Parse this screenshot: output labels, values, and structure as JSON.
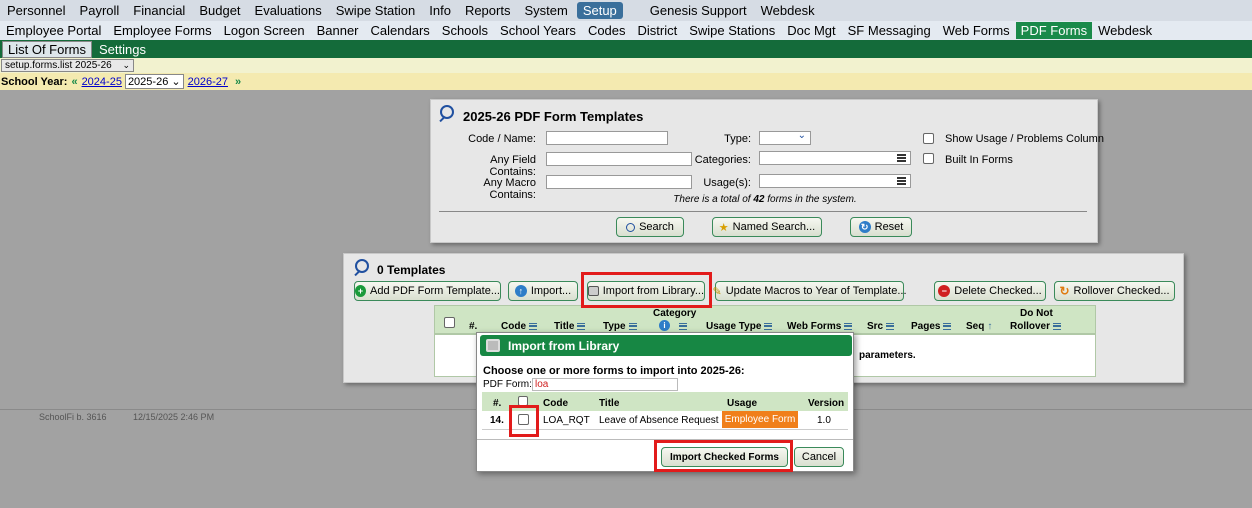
{
  "nav_top": {
    "items": [
      "Personnel",
      "Payroll",
      "Financial",
      "Budget",
      "Evaluations",
      "Swipe Station",
      "Info",
      "Reports",
      "System",
      "Setup",
      "Genesis Support",
      "Webdesk"
    ],
    "selected": "Setup"
  },
  "nav_second": {
    "items": [
      "Employee Portal",
      "Employee Forms",
      "Logon Screen",
      "Banner",
      "Calendars",
      "Schools",
      "School Years",
      "Codes",
      "District",
      "Swipe Stations",
      "Doc Mgt",
      "SF Messaging",
      "Web Forms",
      "PDF Forms",
      "Webdesk"
    ],
    "selected": "PDF Forms"
  },
  "nav_third": {
    "items": [
      "List Of Forms",
      "Settings"
    ],
    "selected": "List Of Forms"
  },
  "page_select": "setup.forms.list 2025-26",
  "school_year": {
    "label": "School Year:",
    "prev": "2024-25",
    "current": "2025-26",
    "next": "2026-27"
  },
  "search_panel": {
    "title": "2025-26 PDF Form Templates",
    "code_name_label": "Code / Name:",
    "any_field_label": "Any Field Contains:",
    "any_macro_label": "Any Macro Contains:",
    "type_label": "Type:",
    "categories_label": "Categories:",
    "usage_label": "Usage(s):",
    "show_usage_label": "Show Usage / Problems Column",
    "built_in_label": "Built In Forms",
    "total_prefix": "There is a total of ",
    "total_count": "42",
    "total_suffix": " forms in the system.",
    "search_btn": "Search",
    "named_search_btn": "Named Search...",
    "reset_btn": "Reset"
  },
  "templates_panel": {
    "title": "0 Templates",
    "add_btn": "Add PDF Form Template...",
    "import_btn": "Import...",
    "import_lib_btn": "Import from Library...",
    "update_macros_btn": "Update Macros to Year of Template...",
    "delete_btn": "Delete Checked...",
    "rollover_btn": "Rollover Checked...",
    "headers": {
      "num": "#.",
      "code": "Code",
      "title": "Title",
      "type": "Type",
      "category": "Category",
      "usage_type": "Usage Type",
      "web_forms": "Web Forms",
      "src": "Src",
      "pages": "Pages",
      "seq": "Seq",
      "do_not": "Do Not",
      "rollover": "Rollover"
    },
    "empty_msg_tail": "parameters."
  },
  "modal": {
    "title": "Import from Library",
    "prompt": "Choose one or more forms to import into 2025-26:",
    "pdf_form_label": "PDF Form:",
    "pdf_form_value": "loa",
    "headers": {
      "num": "#.",
      "code": "Code",
      "title": "Title",
      "usage": "Usage",
      "version": "Version"
    },
    "row": {
      "num": "14.",
      "code": "LOA_RQT",
      "title": "Leave of Absence Request",
      "usage": "Employee Form",
      "version": "1.0"
    },
    "import_btn": "Import Checked Forms",
    "cancel_btn": "Cancel"
  },
  "footer": {
    "build": "SchoolFi b. 3616",
    "datetime": "12/15/2025 2:46 PM"
  },
  "colors": {
    "green": "#178744",
    "highlight": "#e21b1b",
    "usage_badge": "#f07f1a"
  }
}
